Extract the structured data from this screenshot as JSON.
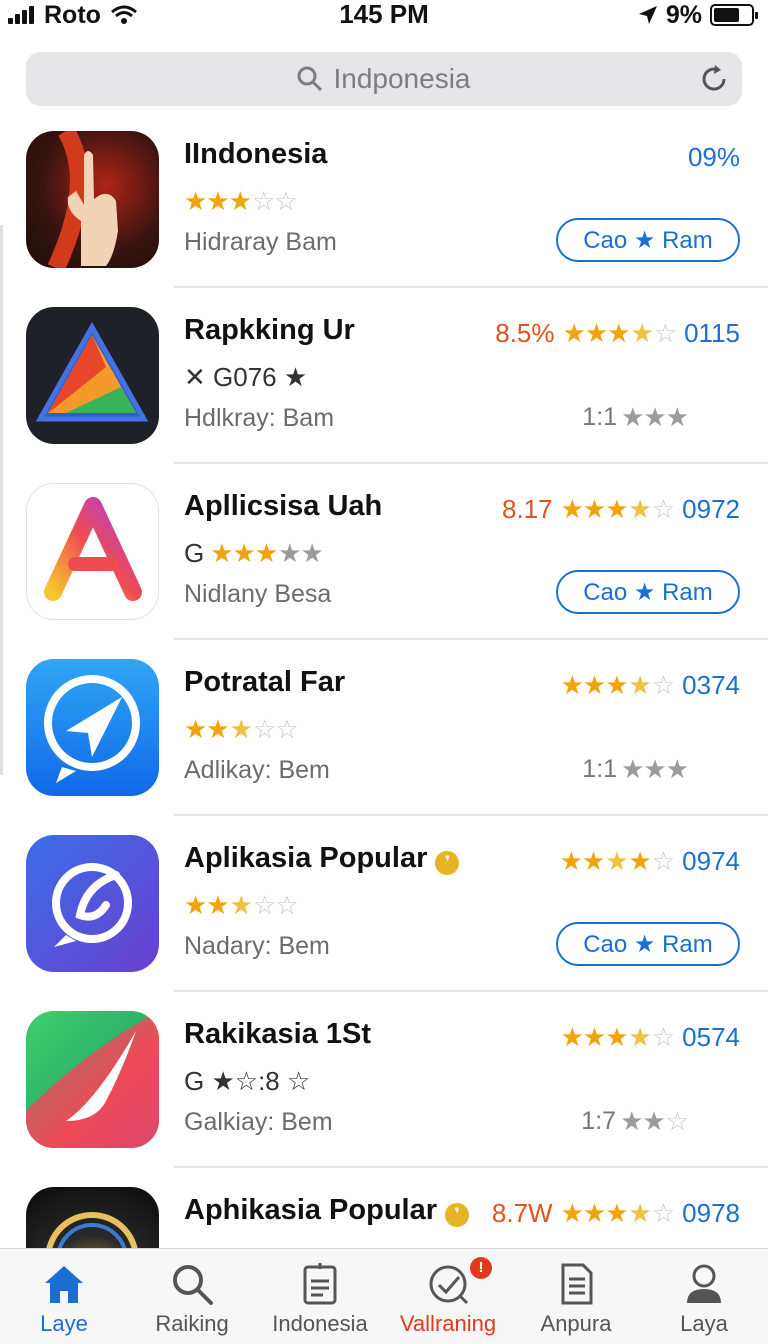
{
  "status_bar": {
    "carrier": "Roto",
    "time": "145 PM",
    "battery": "9%"
  },
  "search": {
    "placeholder": "Indponesia"
  },
  "apps": [
    {
      "title": "IIndonesia",
      "subtitle": "Hidraray Bam",
      "rating_stars": 3,
      "percent": "09%",
      "button": "Cao ★ Ram"
    },
    {
      "title": "Rapkking Ur",
      "meta": "✕ G076 ★",
      "subtitle": "Hdlkray: Bam",
      "percent": "8.5%",
      "rating_stars": 3.5,
      "count": "0115",
      "small_rating": "1:1"
    },
    {
      "title": "Apllicsisa Uah",
      "meta_prefix": "G",
      "subtitle": "Nidlany Besa",
      "percent": "8.17",
      "rating_stars": 3.5,
      "count": "0972",
      "button": "Cao ★ Ram"
    },
    {
      "title": "Potratal Far",
      "subtitle": "Adlikay: Bem",
      "rating_stars": 3.5,
      "count": "0374",
      "small_rating": "1:1"
    },
    {
      "title": "Aplikasia Popular",
      "subtitle": "Nadary: Bem",
      "rating_stars": 3.5,
      "count": "0974",
      "button": "Cao ★ Ram"
    },
    {
      "title": "Rakikasia 1St",
      "meta": "G ★☆:8 ☆",
      "subtitle": "Galkiay: Bem",
      "rating_stars": 3.5,
      "count": "0574",
      "small_rating": "1:7"
    },
    {
      "title": "Aphikasia Popular",
      "percent": "8.7W",
      "rating_stars": 3.5,
      "count": "0978"
    }
  ],
  "tabs": [
    {
      "label": "Laye",
      "icon": "home-icon",
      "active": true
    },
    {
      "label": "Raiking",
      "icon": "search-icon"
    },
    {
      "label": "Indonesia",
      "icon": "document-icon"
    },
    {
      "label": "Vallraning",
      "icon": "check-circle-icon",
      "badge": "!"
    },
    {
      "label": "Anpura",
      "icon": "list-doc-icon"
    },
    {
      "label": "Laya",
      "icon": "person-icon"
    }
  ],
  "colors": {
    "accent": "#1b6fd3",
    "star": "#f0a30a",
    "alert": "#e03a1a"
  }
}
